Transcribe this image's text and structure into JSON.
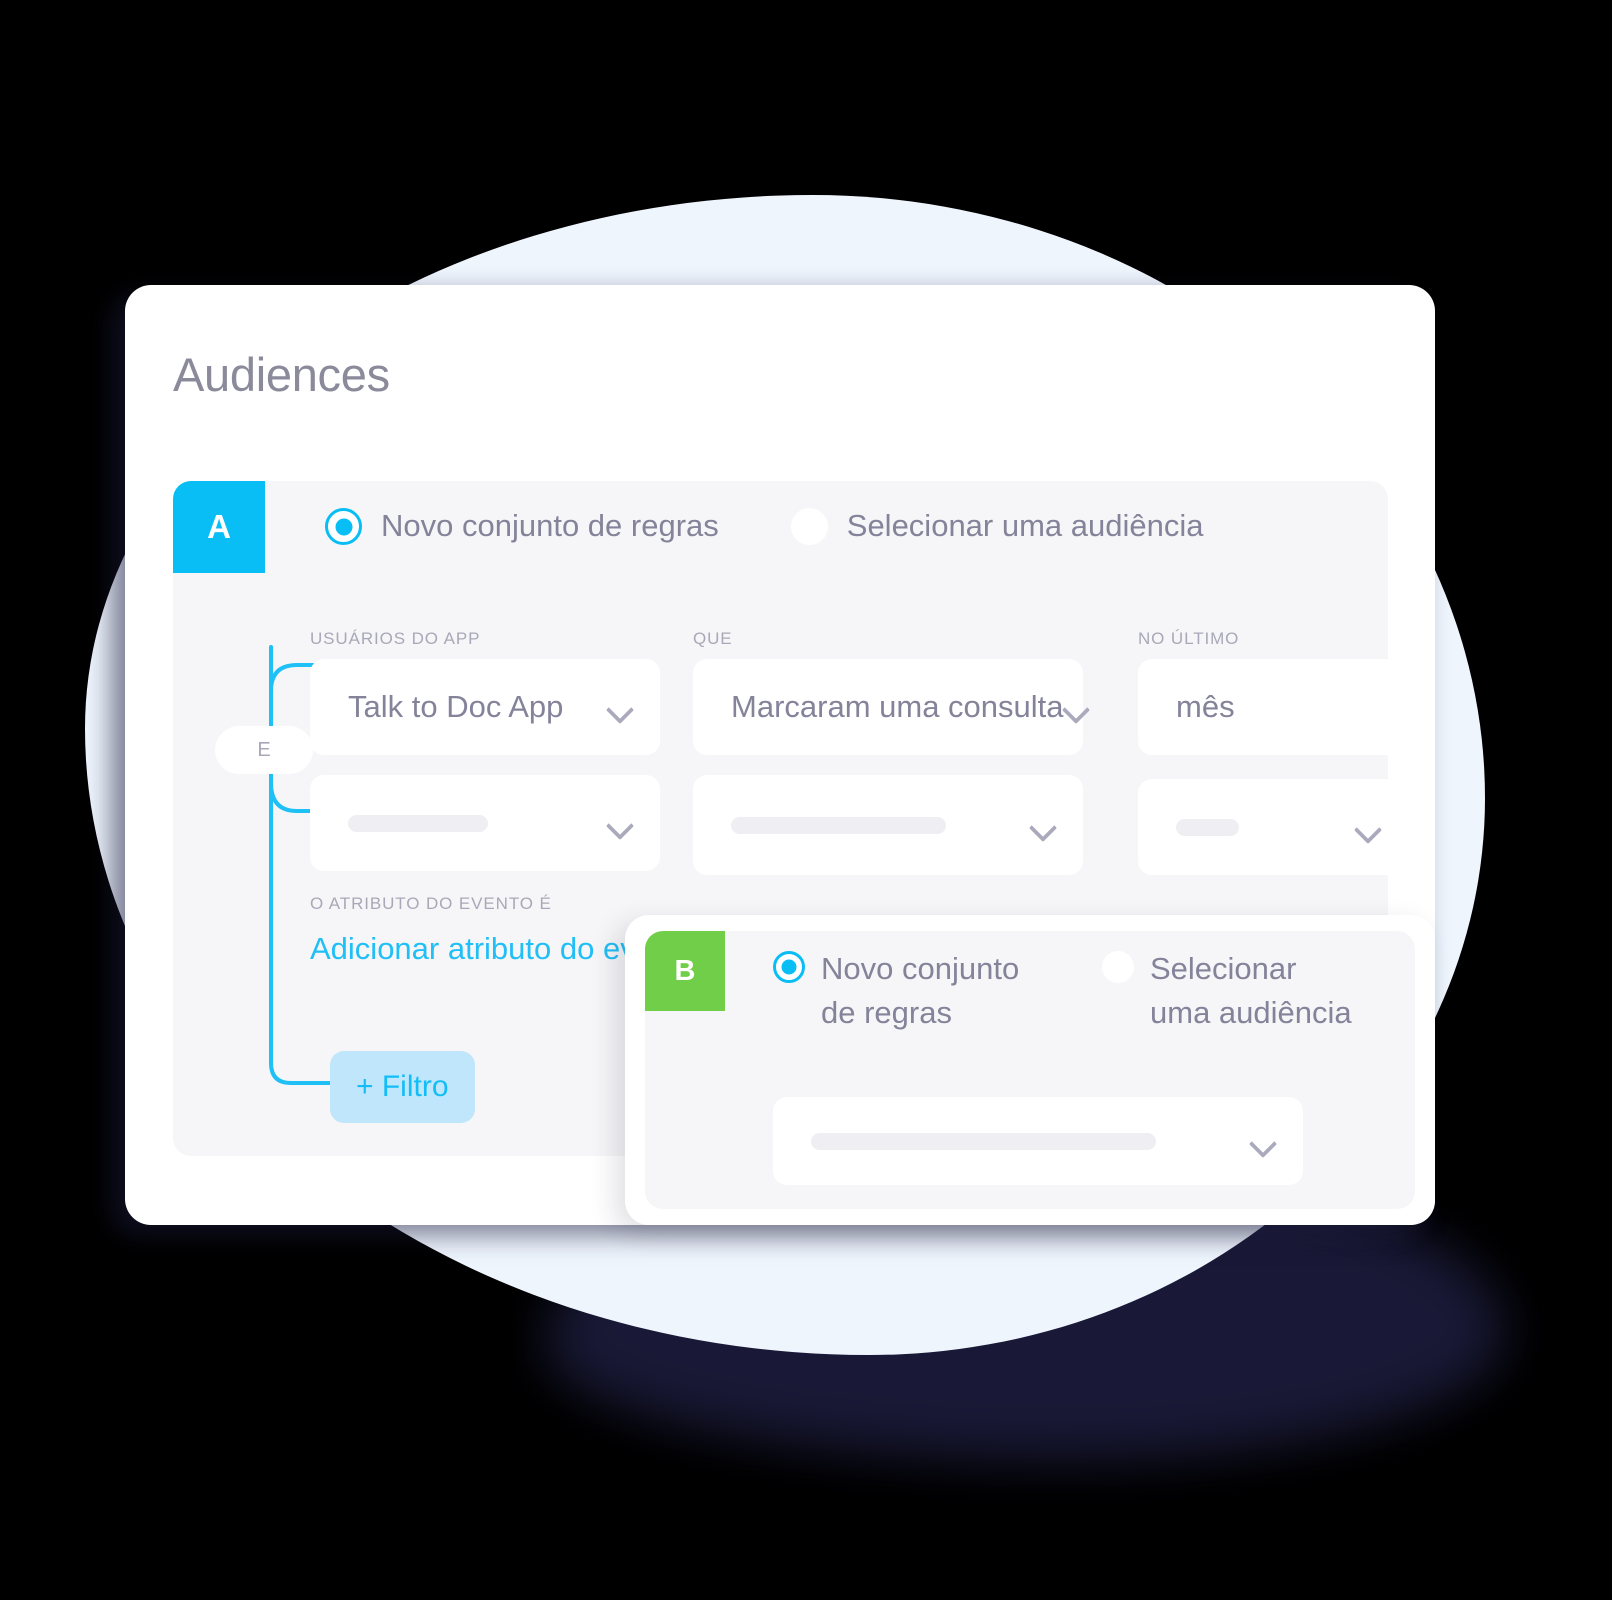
{
  "page": {
    "title": "Audiences"
  },
  "colors": {
    "accent_cyan": "#09BDF5",
    "badge_b_green": "#71CE48",
    "text_muted": "#84839A",
    "label_muted": "#A9A8B8",
    "panel_bg": "#F6F6F8",
    "filter_btn_bg": "#BFE6FA",
    "blob_blue": "#EFF5FD"
  },
  "panel_a": {
    "badge_letter": "A",
    "options": [
      {
        "label": "Novo conjunto de regras",
        "selected": true
      },
      {
        "label": "Selecionar uma audiência",
        "selected": false
      }
    ],
    "fields": [
      {
        "label": "USUÁRIOS DO APP",
        "value": "Talk to Doc App",
        "icon": "chevron-down-icon"
      },
      {
        "label": "QUE",
        "value": "Marcaram uma consulta",
        "icon": "chevron-down-icon"
      },
      {
        "label": "NO ÚLTIMO",
        "value": "mês",
        "icon": ""
      }
    ],
    "fields_row2": [
      {
        "value": "",
        "placeholder_width": 140,
        "icon": "chevron-down-icon"
      },
      {
        "value": "",
        "placeholder_width": 215,
        "icon": "chevron-down-icon"
      },
      {
        "value": "",
        "placeholder_width": 63,
        "icon": "chevron-down-icon"
      }
    ],
    "connector_label": "E",
    "attribute_label": "O ATRIBUTO DO EVENTO É",
    "attribute_link": "Adicionar atributo do evento",
    "filter_button": "+ Filtro"
  },
  "panel_b": {
    "badge_letter": "B",
    "options": [
      {
        "label": "Novo conjunto de regras",
        "selected": true
      },
      {
        "label": "Selecionar uma audiência",
        "selected": false
      }
    ],
    "field": {
      "value": "",
      "placeholder_width": 345,
      "icon": "chevron-down-icon"
    }
  }
}
